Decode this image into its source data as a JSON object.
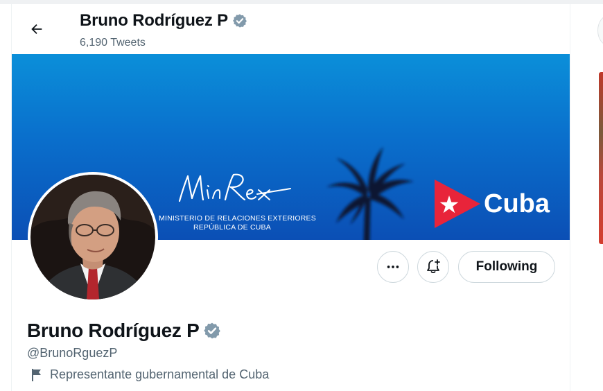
{
  "header": {
    "name": "Bruno Rodríguez P",
    "tweet_count": "6,190 Tweets",
    "back_icon": "arrow-left-icon"
  },
  "banner": {
    "logo_text": "MinRex",
    "line1": "MINISTERIO DE RELACIONES EXTERIORES",
    "line2": "REPÚBLICA DE CUBA",
    "country": "Cuba",
    "background_color": "#0a6fcc"
  },
  "actions": {
    "more_icon": "more-dots-icon",
    "notify_icon": "bell-plus-icon",
    "following_label": "Following"
  },
  "profile": {
    "name": "Bruno Rodríguez P",
    "handle": "@BrunoRguezP",
    "label_icon": "flag-icon",
    "label": "Representante gubernamental de Cuba",
    "verified_badge_color": "#829aab"
  }
}
